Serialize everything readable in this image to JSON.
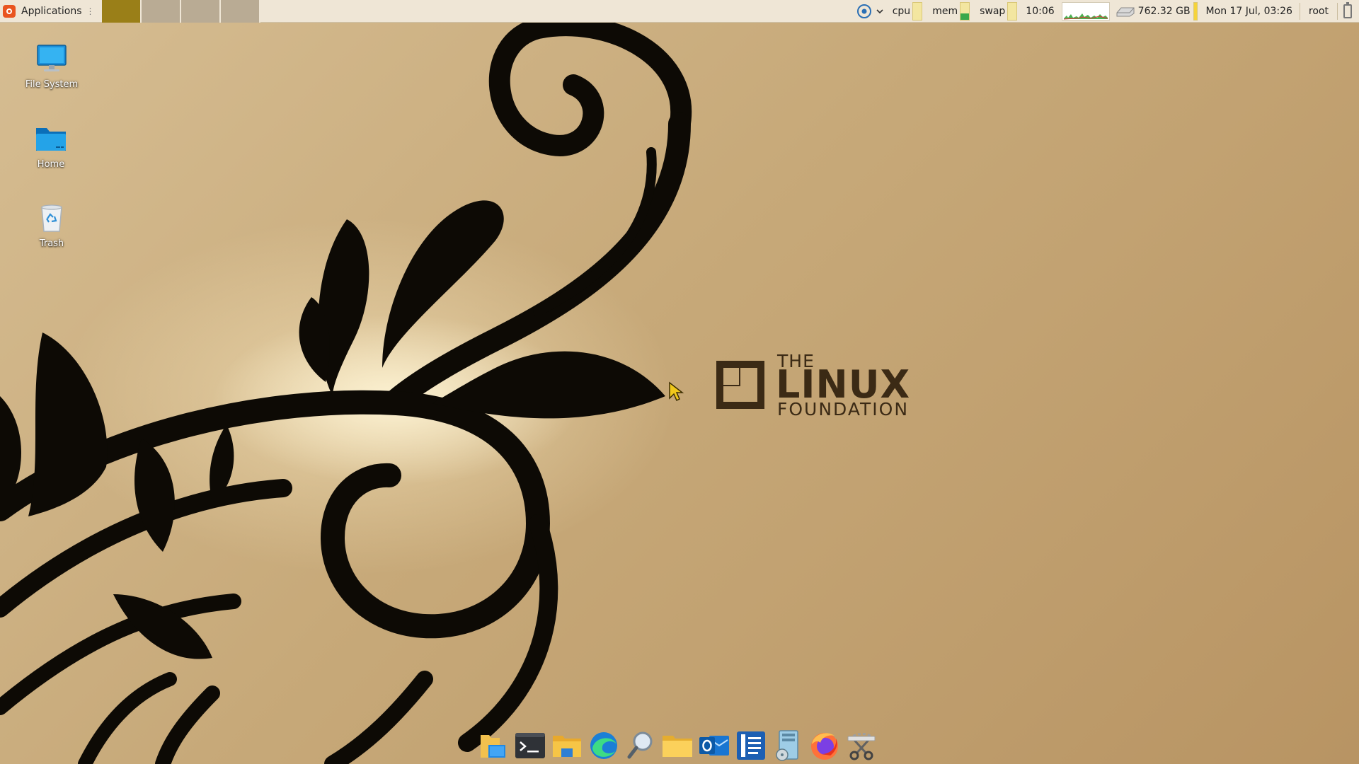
{
  "panel": {
    "applications_label": "Applications",
    "applications_separator": "⋮",
    "workspaces": [
      {
        "name": "workspace-1",
        "active": true
      },
      {
        "name": "workspace-2",
        "active": false
      },
      {
        "name": "workspace-3",
        "active": false
      },
      {
        "name": "workspace-4",
        "active": false
      }
    ],
    "tray": {
      "cpu_label": "cpu",
      "cpu_level": 0.0,
      "mem_label": "mem",
      "mem_level": 0.35,
      "swap_label": "swap",
      "swap_level": 0.0,
      "time_short": "10:06",
      "disk_free": "762.32 GB",
      "datetime": "Mon 17 Jul, 03:26",
      "user": "root"
    },
    "colors": {
      "panel_bg": "#efe6d6",
      "active_workspace": "#9a7f18",
      "inactive_workspace": "#b9ab94"
    }
  },
  "desktop": {
    "icons": [
      {
        "label": "File System",
        "icon": "monitor-icon"
      },
      {
        "label": "Home",
        "icon": "home-folder-icon"
      },
      {
        "label": "Trash",
        "icon": "trash-icon"
      }
    ]
  },
  "wallpaper": {
    "logo_the": "THE",
    "logo_linux": "LINUX",
    "logo_foundation": "FOUNDATION"
  },
  "dock": {
    "items": [
      {
        "name": "file-manager-icon"
      },
      {
        "name": "terminal-icon"
      },
      {
        "name": "files-folder-icon"
      },
      {
        "name": "edge-browser-icon"
      },
      {
        "name": "search-magnifier-icon"
      },
      {
        "name": "folder-icon"
      },
      {
        "name": "outlook-icon"
      },
      {
        "name": "text-editor-icon"
      },
      {
        "name": "disk-utility-icon"
      },
      {
        "name": "firefox-icon"
      },
      {
        "name": "screenshot-tool-icon"
      }
    ]
  }
}
